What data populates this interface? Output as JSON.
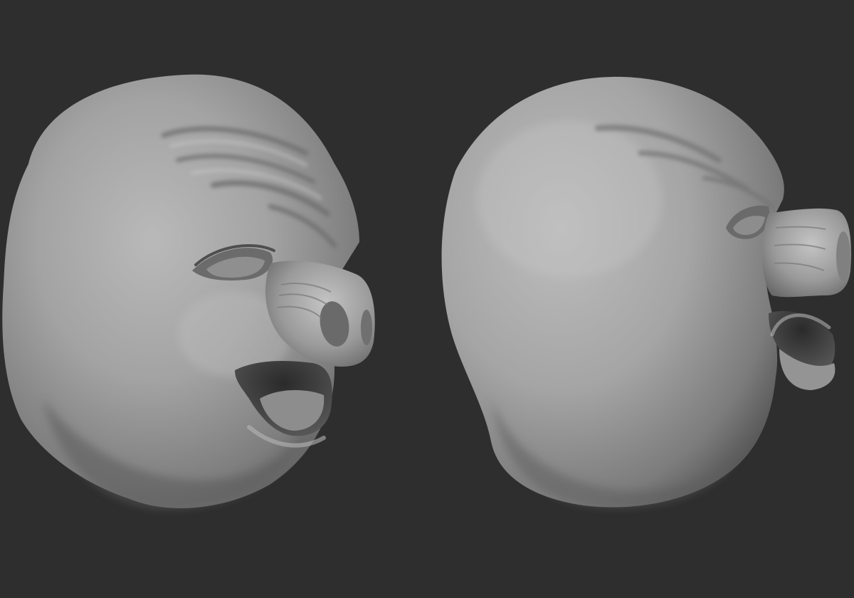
{
  "viewport": {
    "background_color": "#2e2e2e",
    "material_color": "#8a8a8a"
  },
  "models": [
    {
      "name": "pig-head-sculpt",
      "view": "three-quarter-right"
    },
    {
      "name": "pig-head-sculpt",
      "view": "profile-right"
    }
  ]
}
